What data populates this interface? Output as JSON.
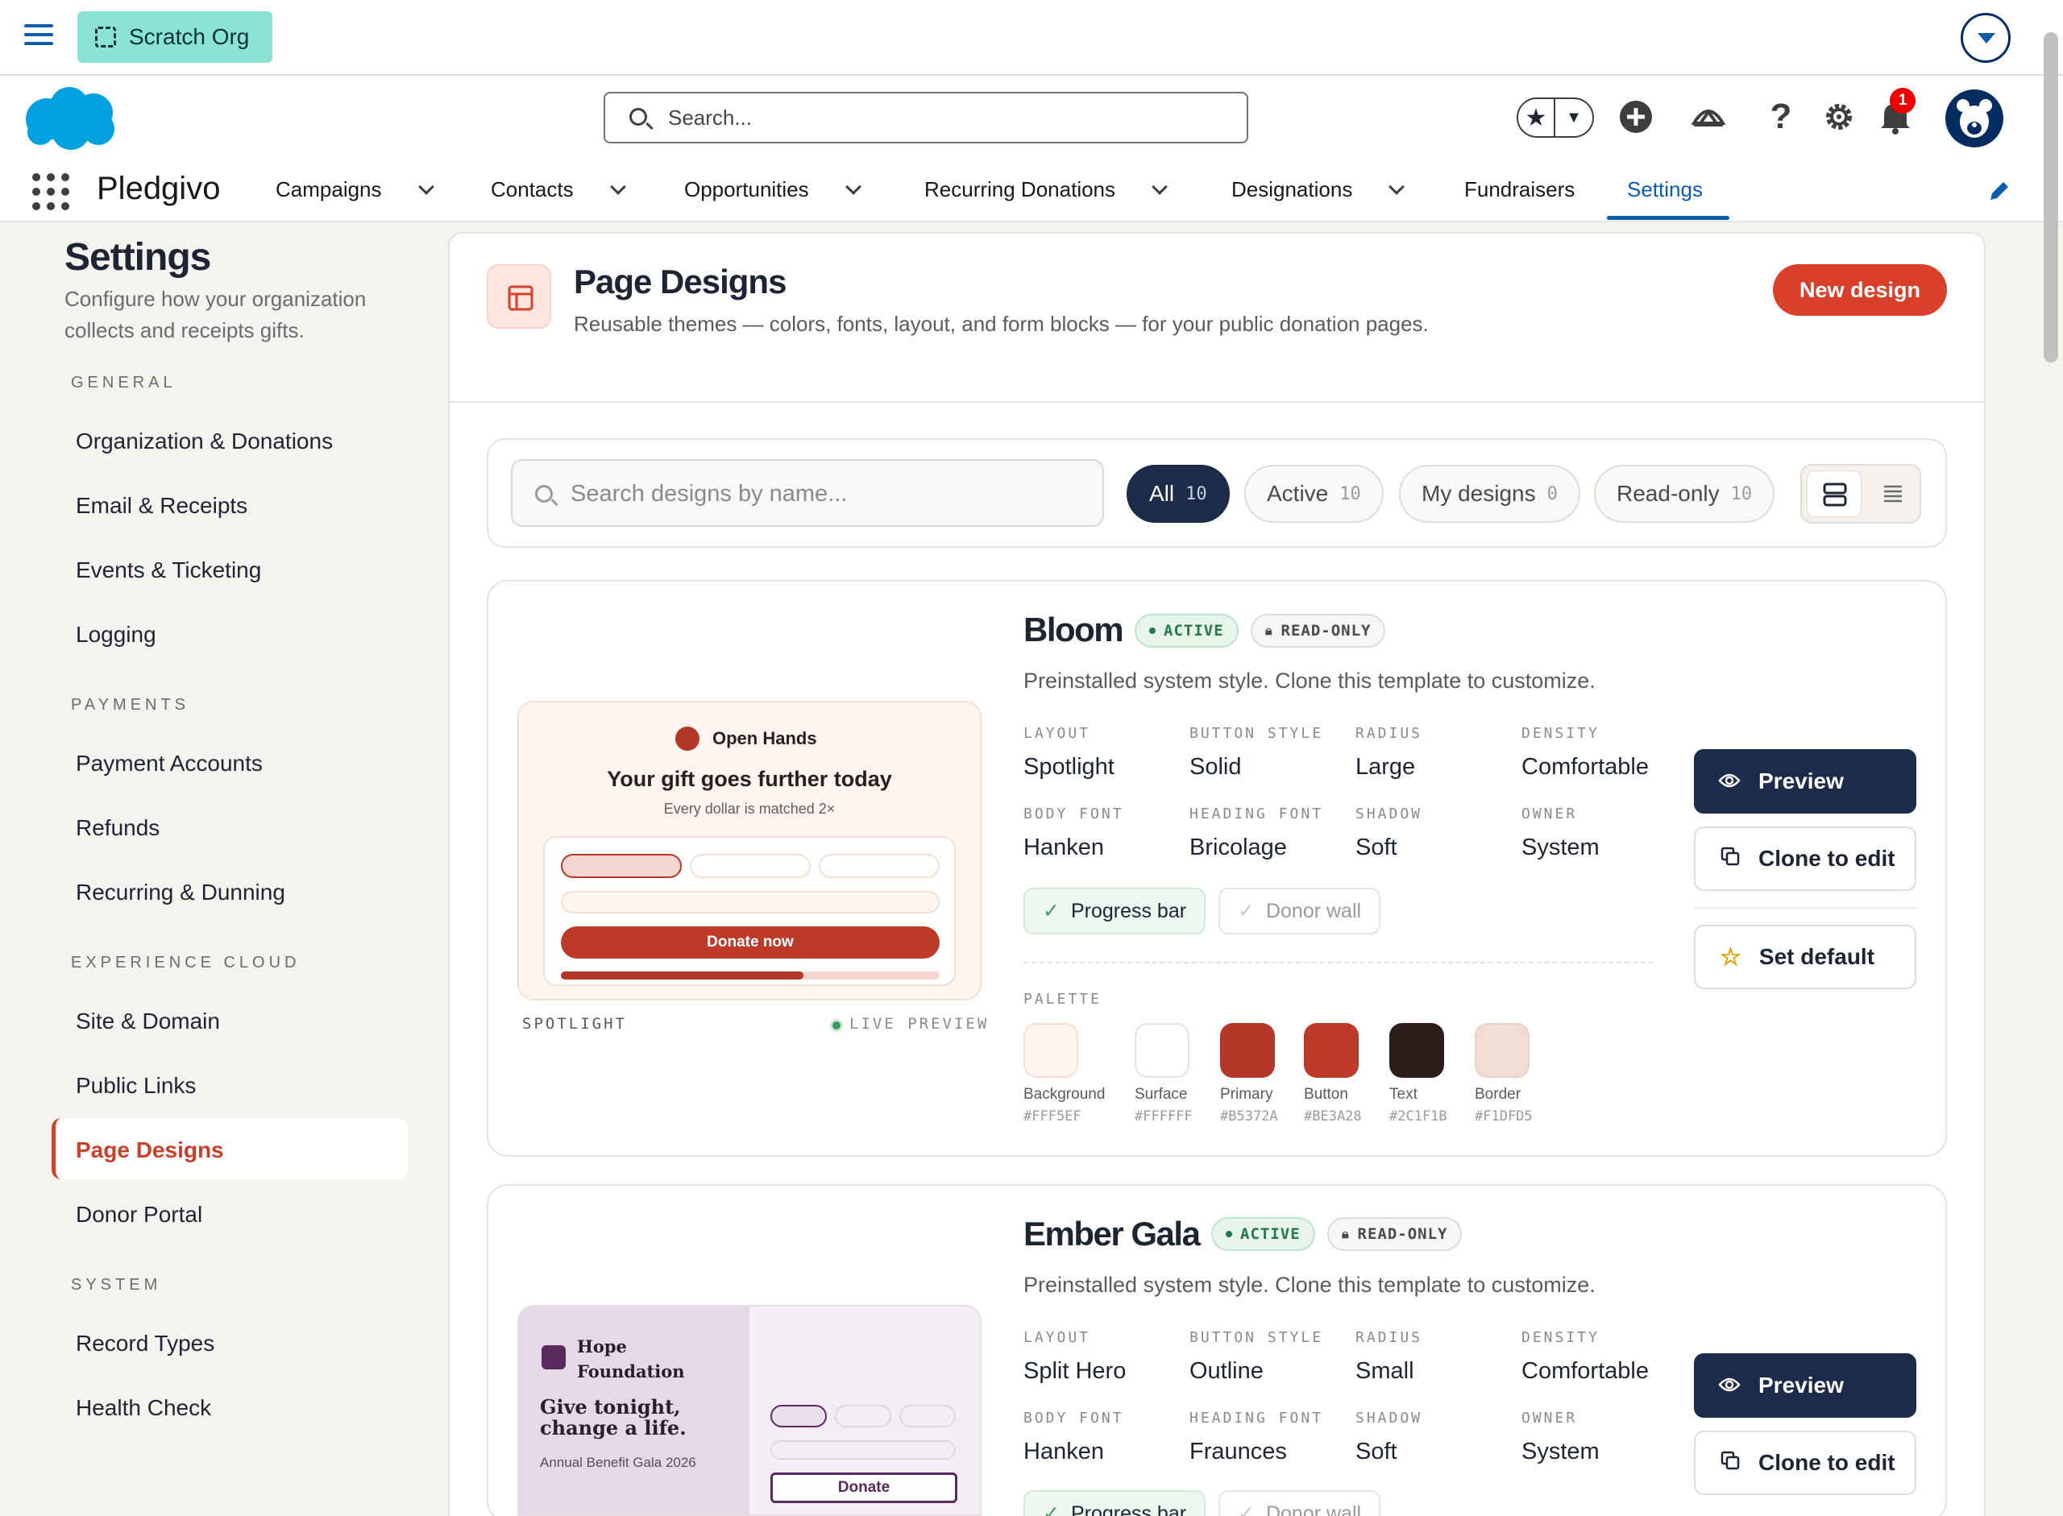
{
  "scratch": {
    "org_label": "Scratch Org"
  },
  "header": {
    "search_placeholder": "Search...",
    "notification_count": "1"
  },
  "nav": {
    "app_name": "Pledgivo",
    "items": [
      {
        "label": "Campaigns",
        "dropdown": true
      },
      {
        "label": "Contacts",
        "dropdown": true
      },
      {
        "label": "Opportunities",
        "dropdown": true
      },
      {
        "label": "Recurring Donations",
        "dropdown": true
      },
      {
        "label": "Designations",
        "dropdown": true
      },
      {
        "label": "Fundraisers",
        "dropdown": false
      },
      {
        "label": "Settings",
        "dropdown": false,
        "active": true
      }
    ]
  },
  "sidebar": {
    "title": "Settings",
    "description": "Configure how your organization collects and receipts gifts.",
    "sections": [
      {
        "label": "GENERAL",
        "items": [
          "Organization & Donations",
          "Email & Receipts",
          "Events & Ticketing",
          "Logging"
        ]
      },
      {
        "label": "PAYMENTS",
        "items": [
          "Payment Accounts",
          "Refunds",
          "Recurring & Dunning"
        ]
      },
      {
        "label": "EXPERIENCE CLOUD",
        "items": [
          "Site & Domain",
          "Public Links",
          "Page Designs",
          "Donor Portal"
        ]
      },
      {
        "label": "SYSTEM",
        "items": [
          "Record Types",
          "Health Check"
        ]
      }
    ],
    "active_item": "Page Designs"
  },
  "page": {
    "title": "Page Designs",
    "description": "Reusable themes — colors, fonts, layout, and form blocks — for your public donation pages.",
    "new_button": "New design"
  },
  "filters": {
    "search_placeholder": "Search designs by name...",
    "pills": [
      {
        "label": "All",
        "count": "10",
        "selected": true
      },
      {
        "label": "Active",
        "count": "10"
      },
      {
        "label": "My designs",
        "count": "0"
      },
      {
        "label": "Read-only",
        "count": "10"
      }
    ]
  },
  "designs": [
    {
      "name": "Bloom",
      "status": "ACTIVE",
      "access": "READ-ONLY",
      "subtitle": "Preinstalled system style. Clone this template to customize.",
      "props": [
        {
          "label": "LAYOUT",
          "value": "Spotlight"
        },
        {
          "label": "BUTTON STYLE",
          "value": "Solid"
        },
        {
          "label": "RADIUS",
          "value": "Large"
        },
        {
          "label": "DENSITY",
          "value": "Comfortable"
        },
        {
          "label": "BODY FONT",
          "value": "Hanken"
        },
        {
          "label": "HEADING FONT",
          "value": "Bricolage"
        },
        {
          "label": "SHADOW",
          "value": "Soft"
        },
        {
          "label": "OWNER",
          "value": "System"
        }
      ],
      "chips": [
        {
          "label": "Progress bar",
          "on": true
        },
        {
          "label": "Donor wall",
          "on": false
        }
      ],
      "palette_label": "PALETTE",
      "palette": [
        {
          "name": "Background",
          "hex": "#FFF5EF"
        },
        {
          "name": "Surface",
          "hex": "#FFFFFF"
        },
        {
          "name": "Primary",
          "hex": "#B5372A"
        },
        {
          "name": "Button",
          "hex": "#BE3A28"
        },
        {
          "name": "Text",
          "hex": "#2C1F1B"
        },
        {
          "name": "Border",
          "hex": "#F1DFD5"
        }
      ],
      "actions": {
        "preview": "Preview",
        "clone": "Clone to edit",
        "set_default": "Set default"
      },
      "preview": {
        "org": "Open Hands",
        "headline": "Your gift goes further today",
        "tagline": "Every dollar is matched 2×",
        "cta": "Donate now",
        "progress": 0.64,
        "layout_label": "SPOTLIGHT",
        "live_label": "LIVE PREVIEW"
      }
    },
    {
      "name": "Ember Gala",
      "status": "ACTIVE",
      "access": "READ-ONLY",
      "subtitle": "Preinstalled system style. Clone this template to customize.",
      "props": [
        {
          "label": "LAYOUT",
          "value": "Split Hero"
        },
        {
          "label": "BUTTON STYLE",
          "value": "Outline"
        },
        {
          "label": "RADIUS",
          "value": "Small"
        },
        {
          "label": "DENSITY",
          "value": "Comfortable"
        },
        {
          "label": "BODY FONT",
          "value": "Hanken"
        },
        {
          "label": "HEADING FONT",
          "value": "Fraunces"
        },
        {
          "label": "SHADOW",
          "value": "Soft"
        },
        {
          "label": "OWNER",
          "value": "System"
        }
      ],
      "chips": [
        {
          "label": "Progress bar",
          "on": true
        },
        {
          "label": "Donor wall",
          "on": false
        }
      ],
      "actions": {
        "preview": "Preview",
        "clone": "Clone to edit"
      },
      "preview": {
        "org": "Hope Foundation",
        "headline": "Give tonight, change a life.",
        "tagline": "Annual Benefit Gala 2026",
        "cta": "Donate"
      }
    }
  ],
  "colors": {
    "brand_blue": "#0b5cab",
    "accent_red": "#d9402b",
    "navy": "#1c2b4a",
    "active_green": "#23784a"
  }
}
